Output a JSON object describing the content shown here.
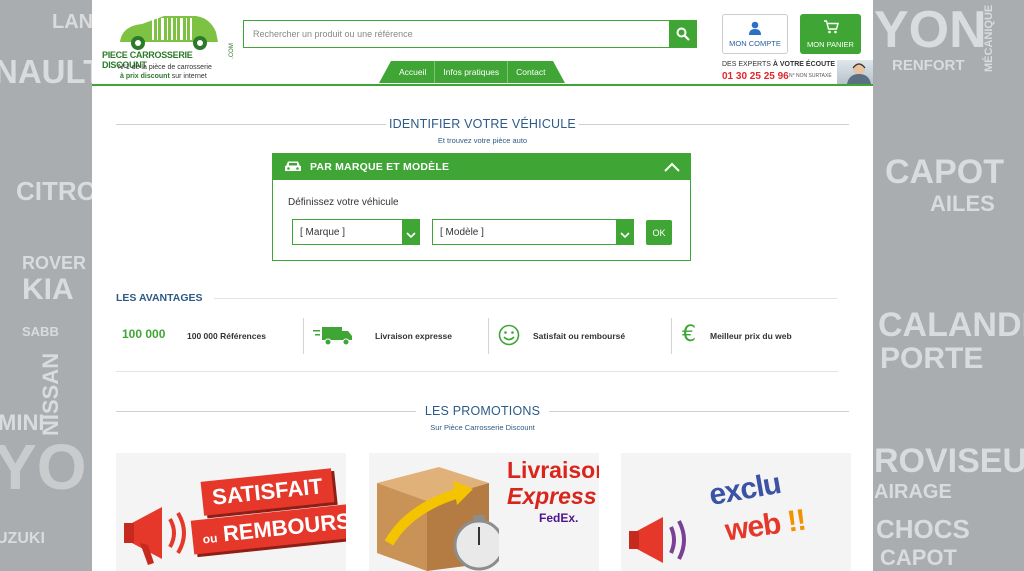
{
  "background_words": [
    "LAN",
    "NAULT",
    "CITRO",
    "ROVER",
    "KIA",
    "SABB",
    "NISSAN",
    "MINI",
    "UZUKI",
    "YO",
    "YON",
    "RENFORT",
    "MÉCANIQUE",
    "CAPOT",
    "AILES",
    "CALANDRE",
    "PORTE",
    "ROVISEUR",
    "AIRAGE",
    "CHOCS",
    "CAPOT"
  ],
  "header": {
    "logo_text": "PIECE CARROSSERIE DISCOUNT",
    "logo_suffix": ".COM",
    "tagline_1": "N°1 de la pièce de carrosserie",
    "tagline_2_bold": "à prix discount",
    "tagline_2_rest": " sur internet",
    "search_placeholder": "Rechercher un produit ou une référence",
    "account_label": "MON COMPTE",
    "cart_label": "MON PANIER",
    "nav": [
      "Accueil",
      "Infos pratiques",
      "Contact"
    ],
    "experts_prefix": "DES EXPERTS ",
    "experts_bold": "À VOTRE ÉCOUTE",
    "phone": "01 30 25 25 96",
    "phone_note": "N° NON SURTAXÉ"
  },
  "identify": {
    "title": "IDENTIFIER VOTRE VÉHICULE",
    "subtitle": "Et trouvez votre pièce auto",
    "panel_title": "PAR MARQUE ET MODÈLE",
    "label": "Définissez votre véhicule",
    "brand_value": "[ Marque ]",
    "model_value": "[ Modèle ]",
    "ok_label": "OK"
  },
  "advantages": {
    "title": "LES AVANTAGES",
    "count_badge": "100 000",
    "items": [
      "100 000 Références",
      "Livraison expresse",
      "Satisfait ou remboursé",
      "Meilleur prix du web"
    ]
  },
  "promotions": {
    "title": "LES PROMOTIONS",
    "subtitle": "Sur Pièce Carrosserie Discount",
    "promo1_line1": "SATISFAIT",
    "promo1_line2_small": "ou",
    "promo1_line2": "REMBOURSÉ",
    "promo2_line1": "Livraison",
    "promo2_line2": "Express",
    "promo2_brand": "FedEx.",
    "promo3_line1": "exclu",
    "promo3_line2": "web"
  },
  "colors": {
    "brand_green": "#3fa535",
    "title_blue": "#2d5a87",
    "phone_red": "#e3262b"
  }
}
